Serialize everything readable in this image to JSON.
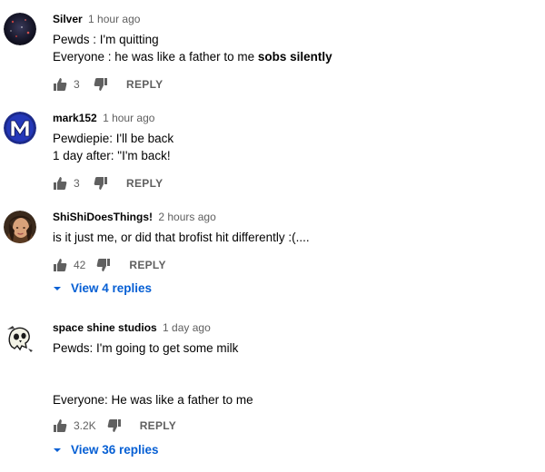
{
  "comments": [
    {
      "author": "Silver",
      "time": "1 hour ago",
      "lines": [
        {
          "text": "Pewds : I'm quitting",
          "bold": ""
        },
        {
          "text": "Everyone : he was like a father to me ",
          "bold": "sobs silently"
        }
      ],
      "likes": "3",
      "reply_label": "REPLY",
      "avatar": "dark-space-avatar"
    },
    {
      "author": "mark152",
      "time": "1 hour ago",
      "lines": [
        {
          "text": "Pewdiepie: I'll be back",
          "bold": ""
        },
        {
          "text": "1 day after: \"I'm back!",
          "bold": ""
        }
      ],
      "likes": "3",
      "reply_label": "REPLY",
      "avatar": "letter-m-avatar"
    },
    {
      "author": "ShiShiDoesThings!",
      "time": "2 hours ago",
      "lines": [
        {
          "text": "is it just me, or did that brofist hit differently :(....",
          "bold": ""
        }
      ],
      "likes": "42",
      "reply_label": "REPLY",
      "view_replies": "View 4 replies",
      "avatar": "person-photo-avatar"
    },
    {
      "author": "space shine studios",
      "time": "1 day ago",
      "lines": [
        {
          "text": "Pewds: I'm going to get some milk",
          "bold": ""
        },
        {
          "text": "",
          "bold": ""
        },
        {
          "text": "",
          "bold": ""
        },
        {
          "text": "Everyone: He was like a father to me",
          "bold": ""
        }
      ],
      "likes": "3.2K",
      "reply_label": "REPLY",
      "view_replies": "View 36 replies",
      "avatar": "cartoon-skull-avatar"
    }
  ],
  "colors": {
    "link": "#065fd4",
    "meta": "#606060",
    "text": "#030303"
  }
}
